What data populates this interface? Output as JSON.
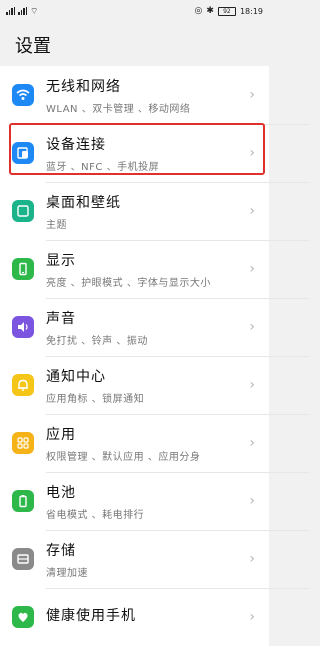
{
  "status_bar": {
    "signal_text": "ⁱˡˡ ⁱˡˡ",
    "battery": "92",
    "time": "18:19"
  },
  "page": {
    "title": "设置"
  },
  "items": [
    {
      "title": "无线和网络",
      "subtitle": "WLAN 、双卡管理 、移动网络",
      "icon": "wifi-icon",
      "color": "#1e88f5"
    },
    {
      "title": "设备连接",
      "subtitle": "蓝牙 、NFC 、手机投屏",
      "icon": "device-connection-icon",
      "color": "#1e88f5"
    },
    {
      "title": "桌面和壁纸",
      "subtitle": "主题",
      "icon": "wallpaper-icon",
      "color": "#1ab38a"
    },
    {
      "title": "显示",
      "subtitle": "亮度 、护眼模式 、字体与显示大小",
      "icon": "display-icon",
      "color": "#2eb84a"
    },
    {
      "title": "声音",
      "subtitle": "免打扰 、铃声 、振动",
      "icon": "sound-icon",
      "color": "#7b55e0"
    },
    {
      "title": "通知中心",
      "subtitle": "应用角标 、锁屏通知",
      "icon": "notification-icon",
      "color": "#f5c518"
    },
    {
      "title": "应用",
      "subtitle": "权限管理 、默认应用 、应用分身",
      "icon": "apps-icon",
      "color": "#f5b318"
    },
    {
      "title": "电池",
      "subtitle": "省电模式 、耗电排行",
      "icon": "battery-icon",
      "color": "#2eb84a"
    },
    {
      "title": "存储",
      "subtitle": "清理加速",
      "icon": "storage-icon",
      "color": "#8a8a8a"
    },
    {
      "title": "健康使用手机",
      "subtitle": "",
      "icon": "digital-health-icon",
      "color": "#2eb84a"
    }
  ]
}
